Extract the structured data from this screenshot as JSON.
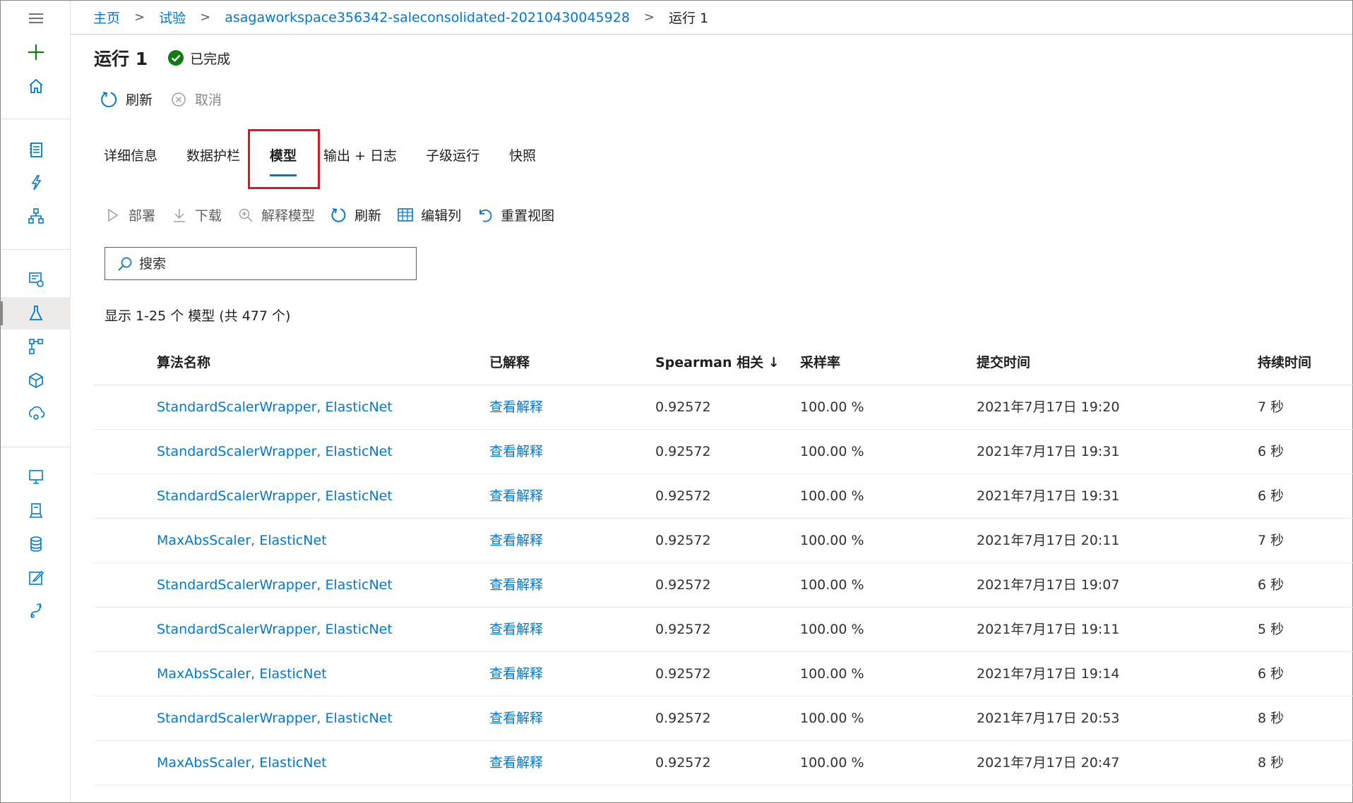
{
  "breadcrumb": {
    "home": "主页",
    "experiments": "试验",
    "experiment_name": "asagaworkspace356342-saleconsolidated-20210430045928",
    "current": "运行 1"
  },
  "run": {
    "title": "运行 1",
    "status": "已完成",
    "status_color": "#107c10"
  },
  "commands": {
    "refresh": "刷新",
    "cancel": "取消"
  },
  "tabs": [
    {
      "label": "详细信息"
    },
    {
      "label": "数据护栏"
    },
    {
      "label": "模型",
      "active": true
    },
    {
      "label": "输出 + 日志"
    },
    {
      "label": "子级运行"
    },
    {
      "label": "快照"
    }
  ],
  "toolbar": {
    "deploy": "部署",
    "download": "下载",
    "explain": "解释模型",
    "refresh": "刷新",
    "edit_columns": "编辑列",
    "reset_view": "重置视图"
  },
  "search": {
    "placeholder": "搜索"
  },
  "summary": "显示 1-25 个 模型 (共 477 个)",
  "table": {
    "headers": [
      "算法名称",
      "已解释",
      "Spearman 相关 ↓",
      "采样率",
      "提交时间",
      "持续时间"
    ],
    "rows": [
      [
        "StandardScalerWrapper, ElasticNet",
        "查看解释",
        "0.92572",
        "100.00 %",
        "2021年7月17日 19:20",
        "7 秒"
      ],
      [
        "StandardScalerWrapper, ElasticNet",
        "查看解释",
        "0.92572",
        "100.00 %",
        "2021年7月17日 19:31",
        "6 秒"
      ],
      [
        "StandardScalerWrapper, ElasticNet",
        "查看解释",
        "0.92572",
        "100.00 %",
        "2021年7月17日 19:31",
        "6 秒"
      ],
      [
        "MaxAbsScaler, ElasticNet",
        "查看解释",
        "0.92572",
        "100.00 %",
        "2021年7月17日 20:11",
        "7 秒"
      ],
      [
        "StandardScalerWrapper, ElasticNet",
        "查看解释",
        "0.92572",
        "100.00 %",
        "2021年7月17日 19:07",
        "6 秒"
      ],
      [
        "StandardScalerWrapper, ElasticNet",
        "查看解释",
        "0.92572",
        "100.00 %",
        "2021年7月17日 19:11",
        "5 秒"
      ],
      [
        "MaxAbsScaler, ElasticNet",
        "查看解释",
        "0.92572",
        "100.00 %",
        "2021年7月17日 19:14",
        "6 秒"
      ],
      [
        "StandardScalerWrapper, ElasticNet",
        "查看解释",
        "0.92572",
        "100.00 %",
        "2021年7月17日 20:53",
        "8 秒"
      ],
      [
        "MaxAbsScaler, ElasticNet",
        "查看解释",
        "0.92572",
        "100.00 %",
        "2021年7月17日 20:47",
        "8 秒"
      ]
    ]
  },
  "colors": {
    "link": "#0078d4",
    "highlight": "#e81123",
    "new_icon": "#107c10"
  },
  "icons": {
    "rail": [
      "hamburger-icon",
      "add-icon",
      "home-icon",
      "notebook-icon",
      "automl-icon",
      "designer-icon",
      "datasets-icon",
      "experiments-icon",
      "pipelines-icon",
      "models-icon",
      "endpoints-icon",
      "compute-icon",
      "environments-icon",
      "datastores-icon",
      "data-labeling-icon",
      "linked-services-icon"
    ]
  }
}
